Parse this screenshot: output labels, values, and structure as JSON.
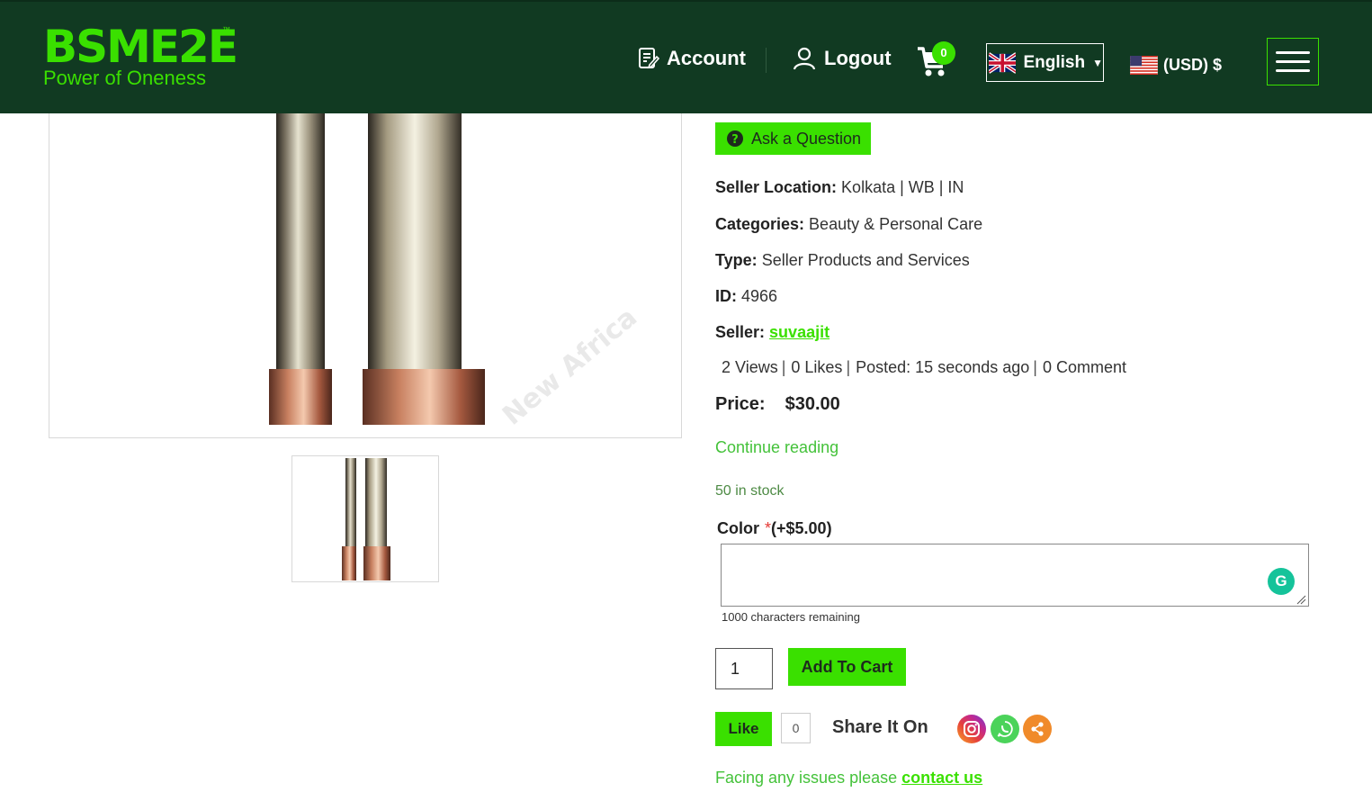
{
  "header": {
    "logo_main": "BSME2E",
    "logo_tm": "™",
    "logo_sub": "Power of Oneness",
    "account_label": "Account",
    "logout_label": "Logout",
    "cart_count": "0",
    "language": "English",
    "currency": "(USD) $"
  },
  "product": {
    "ask_label": "Ask a Question",
    "seller_location_label": "Seller Location:",
    "seller_location": "Kolkata | WB | IN",
    "categories_label": "Categories:",
    "categories": "Beauty & Personal Care",
    "type_label": "Type:",
    "type": "Seller Products and Services",
    "id_label": "ID:",
    "id": "4966",
    "seller_label": "Seller:",
    "seller": "suvaajit",
    "views": "2 Views",
    "likes": "0 Likes",
    "posted": "Posted: 15 seconds ago",
    "comments": "0 Comment",
    "price_label": "Price:",
    "price": "$30.00",
    "continue_label": "Continue reading",
    "stock": "50 in stock",
    "color_label": "Color",
    "color_required": "*",
    "color_extra": "(+$5.00)",
    "color_value": "",
    "chars_remaining": "1000 characters remaining",
    "quantity": "1",
    "add_to_cart": "Add To Cart",
    "like_label": "Like",
    "like_count": "0",
    "share_label": "Share It On",
    "issues_text": "Facing any issues please",
    "contact_label": "contact us"
  },
  "colors": {
    "header_bg": "#113a22",
    "accent_green": "#3ae000",
    "link_green": "#44c23a"
  },
  "icons": [
    "document-icon",
    "user-icon",
    "cart-icon",
    "uk-flag-icon",
    "us-flag-icon",
    "hamburger-menu-icon",
    "question-circle-icon",
    "grammarly-icon",
    "instagram-icon",
    "whatsapp-icon",
    "share-icon"
  ]
}
